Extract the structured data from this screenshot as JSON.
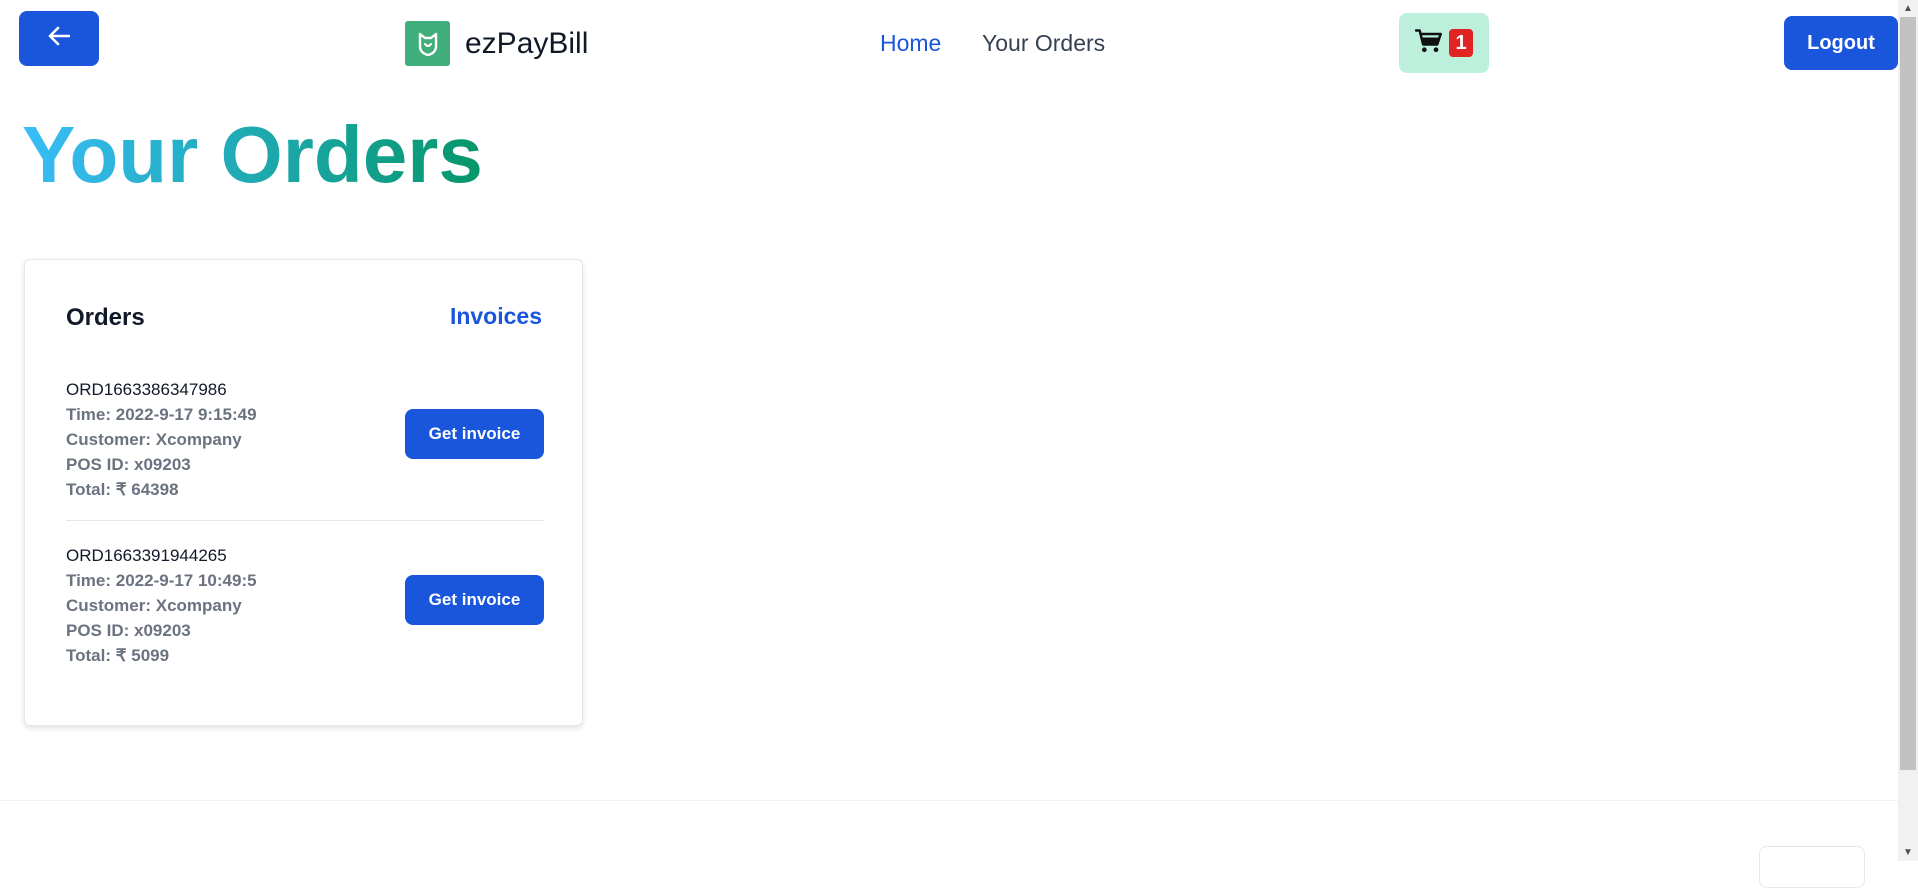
{
  "header": {
    "brand_name": "ezPayBill",
    "nav": {
      "home": "Home",
      "orders": "Your Orders"
    },
    "cart_count": "1",
    "logout_label": "Logout"
  },
  "page": {
    "title": "Your Orders"
  },
  "card": {
    "title": "Orders",
    "invoices_link": "Invoices",
    "orders": [
      {
        "id": "ORD1663386347986",
        "time": "Time: 2022-9-17 9:15:49",
        "customer": "Customer: Xcompany",
        "pos": "POS ID: x09203",
        "total": "Total: ₹ 64398",
        "button": "Get invoice"
      },
      {
        "id": "ORD1663391944265",
        "time": "Time: 2022-9-17 10:49:5",
        "customer": "Customer: Xcompany",
        "pos": "POS ID: x09203",
        "total": "Total: ₹ 5099",
        "button": "Get invoice"
      }
    ]
  },
  "icons": {
    "back": "arrow-left-icon",
    "logo": "mi-shield-logo-icon",
    "cart": "shopping-cart-icon"
  },
  "colors": {
    "primary": "#1a56db",
    "brand_green": "#3fae7a",
    "cart_bg": "#bdf0dc",
    "badge_red": "#e02424",
    "title_gradient_start": "#38bdf8",
    "title_gradient_end": "#059669"
  }
}
